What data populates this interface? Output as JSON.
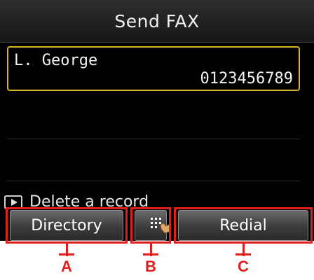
{
  "screen": {
    "title": "Send FAX",
    "entry": {
      "name": "L. George",
      "number": "0123456789"
    },
    "hint": {
      "icon": "play-icon",
      "label": "Delete a record"
    }
  },
  "buttons": {
    "directory_label": "Directory",
    "keypad_icon": "keypad-touch-icon",
    "redial_label": "Redial"
  },
  "callouts": [
    "A",
    "B",
    "C"
  ],
  "colors": {
    "screen_bg": "#000000",
    "selection_border": "#d6b12a",
    "callout_red": "#e01e1e"
  }
}
